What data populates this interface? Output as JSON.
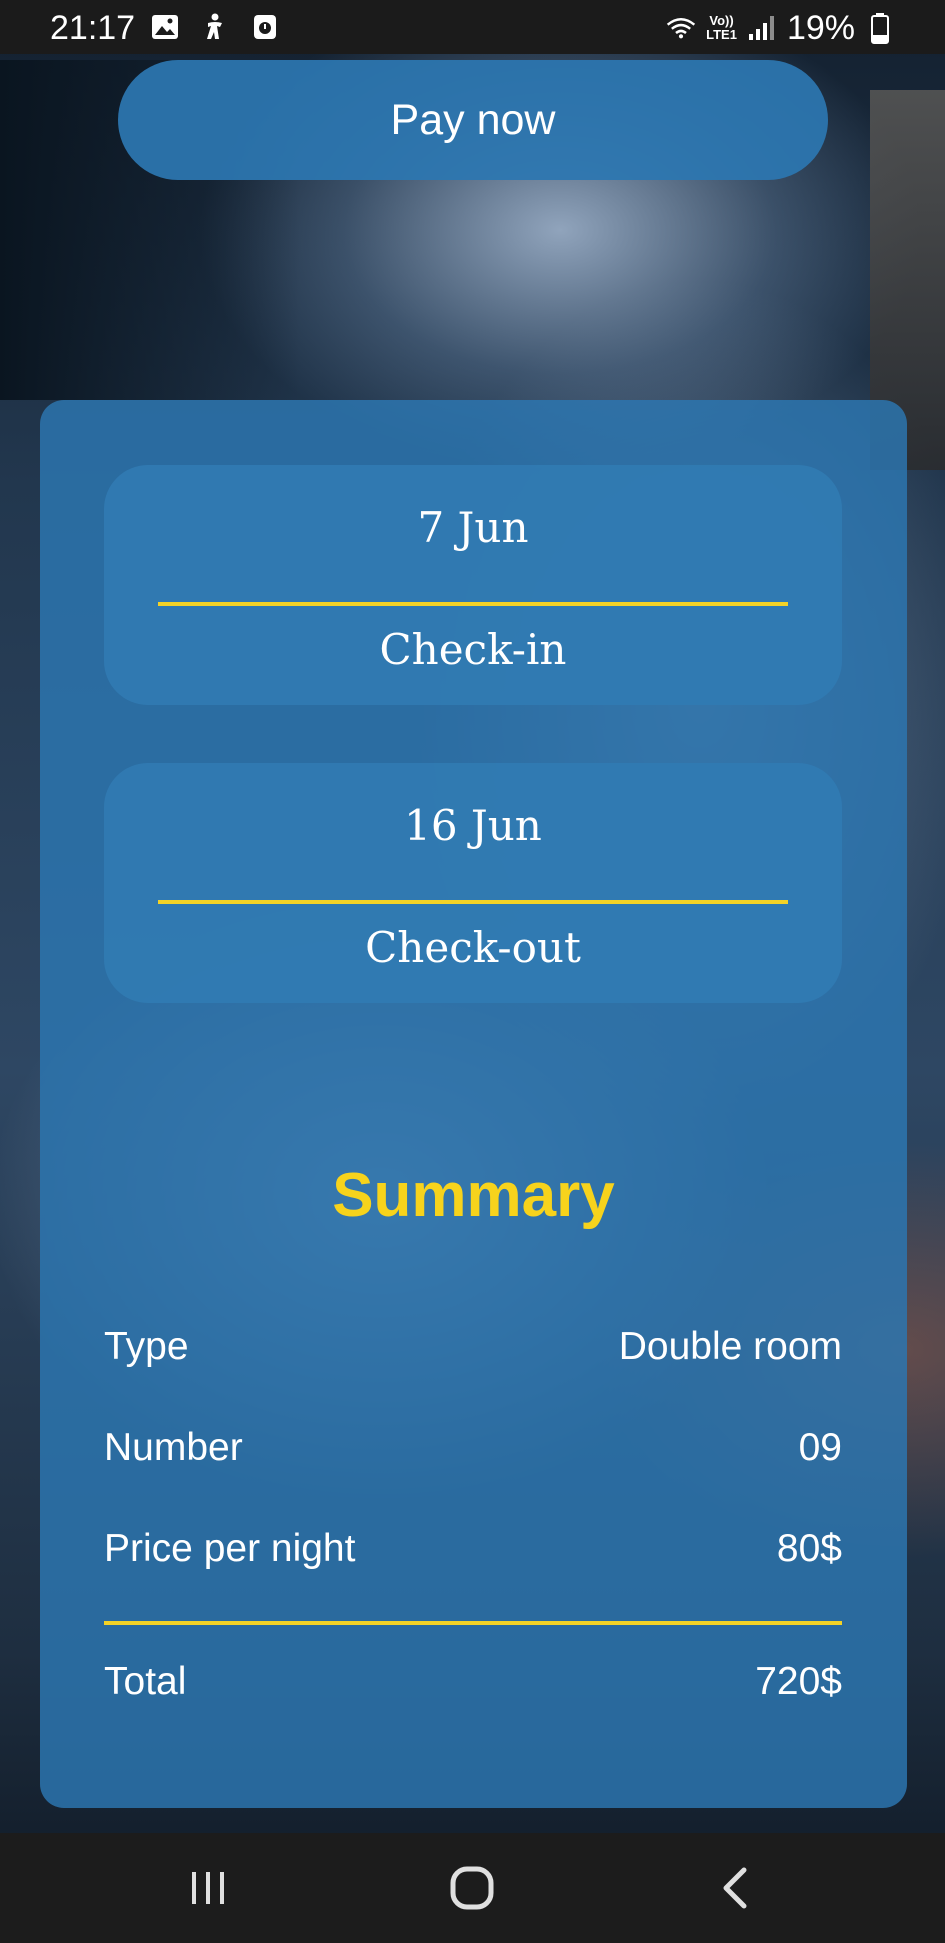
{
  "status_bar": {
    "time": "21:17",
    "icons_left": [
      "image-icon",
      "accessibility-icon",
      "media-icon"
    ],
    "signal_label": "Vo))\nLTE1",
    "battery": "19%"
  },
  "pay_button": {
    "label": "Pay now"
  },
  "booking": {
    "checkin": {
      "date": "7 Jun",
      "label": "Check-in"
    },
    "checkout": {
      "date": "16 Jun",
      "label": "Check-out"
    }
  },
  "summary": {
    "title": "Summary",
    "rows": [
      {
        "label": "Type",
        "value": "Double room"
      },
      {
        "label": "Number",
        "value": "09"
      },
      {
        "label": "Price per night",
        "value": "80$"
      }
    ],
    "total": {
      "label": "Total",
      "value": "720$"
    }
  },
  "colors": {
    "accent": "#f3d226",
    "card": "#2c76b0",
    "text": "#ffffff"
  }
}
